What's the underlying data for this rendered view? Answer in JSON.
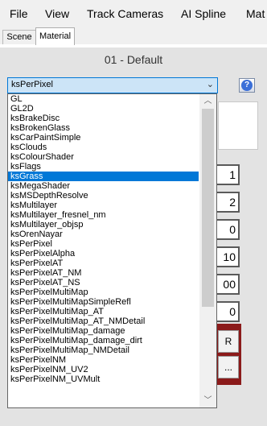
{
  "menu": [
    "File",
    "View",
    "Track Cameras",
    "AI Spline",
    "Mat"
  ],
  "tabs": {
    "scene": "Scene",
    "material": "Material"
  },
  "material_title": "01 - Default",
  "shader_select": {
    "value": "ksPerPixel",
    "arrow": "⌄"
  },
  "help": {
    "glyph": "?"
  },
  "side_values": [
    "1",
    "2",
    "0",
    "10",
    "00",
    "0"
  ],
  "red_buttons": [
    "R",
    "..."
  ],
  "scroll": {
    "up": "︿",
    "down": "﹀"
  },
  "shader_options": [
    "GL",
    "GL2D",
    "ksBrakeDisc",
    "ksBrokenGlass",
    "ksCarPaintSimple",
    "ksClouds",
    "ksColourShader",
    "ksFlags",
    "ksGrass",
    "ksMegaShader",
    "ksMSDepthResolve",
    "ksMultilayer",
    "ksMultilayer_fresnel_nm",
    "ksMultilayer_objsp",
    "ksOrenNayar",
    "ksPerPixel",
    "ksPerPixelAlpha",
    "ksPerPixelAT",
    "ksPerPixelAT_NM",
    "ksPerPixelAT_NS",
    "ksPerPixelMultiMap",
    "ksPerPixelMultiMapSimpleRefl",
    "ksPerPixelMultiMap_AT",
    "ksPerPixelMultiMap_AT_NMDetail",
    "ksPerPixelMultiMap_damage",
    "ksPerPixelMultiMap_damage_dirt",
    "ksPerPixelMultiMap_NMDetail",
    "ksPerPixelNM",
    "ksPerPixelNM_UV2",
    "ksPerPixelNM_UVMult"
  ],
  "highlighted_option": "ksGrass"
}
